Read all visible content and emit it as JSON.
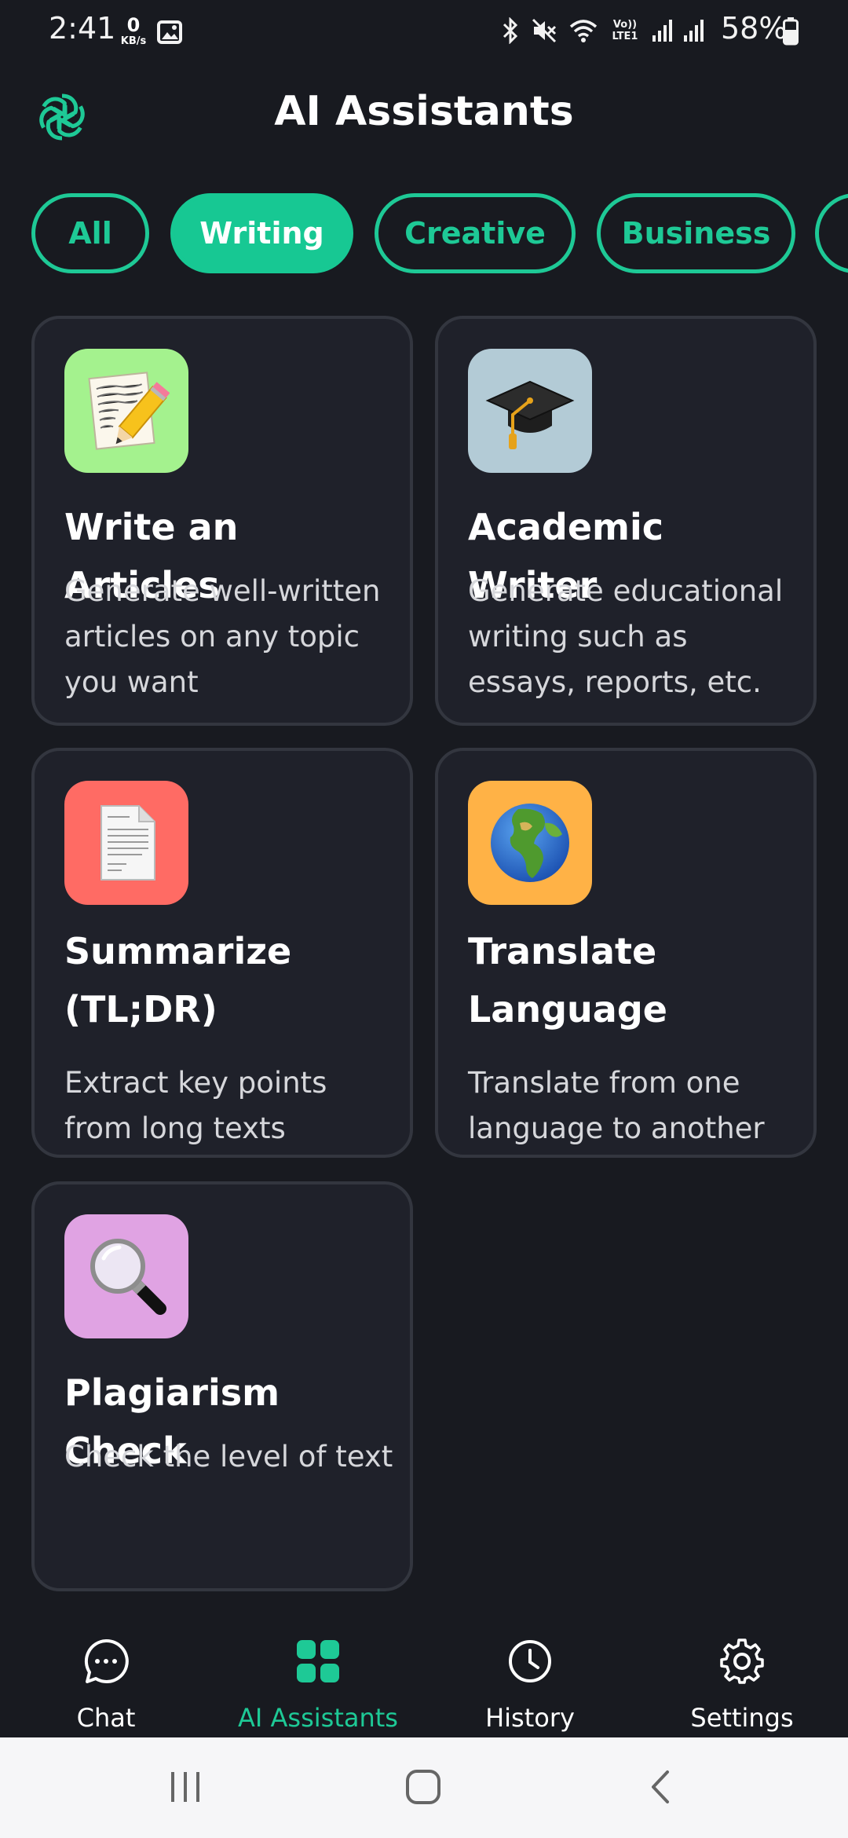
{
  "status_bar": {
    "time": "2:41",
    "net_speed_value": "0",
    "net_speed_unit": "KB/s",
    "volte_label": "Vo)) LTE1",
    "battery_percent": "58%",
    "icons": [
      "gallery-icon",
      "bluetooth-icon",
      "mute-icon",
      "wifi-icon",
      "volte-icon",
      "signal-icon",
      "signal-icon",
      "battery-icon"
    ]
  },
  "header": {
    "title": "AI Assistants",
    "logo_icon": "openai-logo-icon"
  },
  "filters": {
    "chips": [
      {
        "label": "All",
        "active": false
      },
      {
        "label": "Writing",
        "active": true
      },
      {
        "label": "Creative",
        "active": false
      },
      {
        "label": "Business",
        "active": false
      }
    ]
  },
  "assistants": [
    {
      "title": "Write an Articles",
      "description": "Generate well-written articles on any topic you want",
      "icon": "memo-emoji-icon",
      "icon_bg": "#a4f28e"
    },
    {
      "title": "Academic Writer",
      "description": "Generate educational writing such as essays, reports, etc.",
      "icon": "graduation-cap-emoji-icon",
      "icon_bg": "#b3cbd6"
    },
    {
      "title": "Summarize (TL;DR)",
      "description": "Extract key points from long texts",
      "icon": "document-emoji-icon",
      "icon_bg": "#ff6b64"
    },
    {
      "title": "Translate Language",
      "description": "Translate from one language to another",
      "icon": "globe-emoji-icon",
      "icon_bg": "#ffb246"
    },
    {
      "title": "Plagiarism Check",
      "description": "Check the level of text",
      "icon": "magnifier-emoji-icon",
      "icon_bg": "#e0a3e3"
    }
  ],
  "bottom_nav": {
    "items": [
      {
        "label": "Chat",
        "icon": "chat-bubble-icon",
        "active": false
      },
      {
        "label": "AI Assistants",
        "icon": "grid-icon",
        "active": true
      },
      {
        "label": "History",
        "icon": "clock-icon",
        "active": false
      },
      {
        "label": "Settings",
        "icon": "gear-icon",
        "active": false
      }
    ]
  },
  "system_nav": {
    "buttons": [
      "recent-apps-icon",
      "home-icon",
      "back-icon"
    ]
  },
  "colors": {
    "accent": "#1ec996",
    "background": "#181a20",
    "card": "#1f212a"
  }
}
